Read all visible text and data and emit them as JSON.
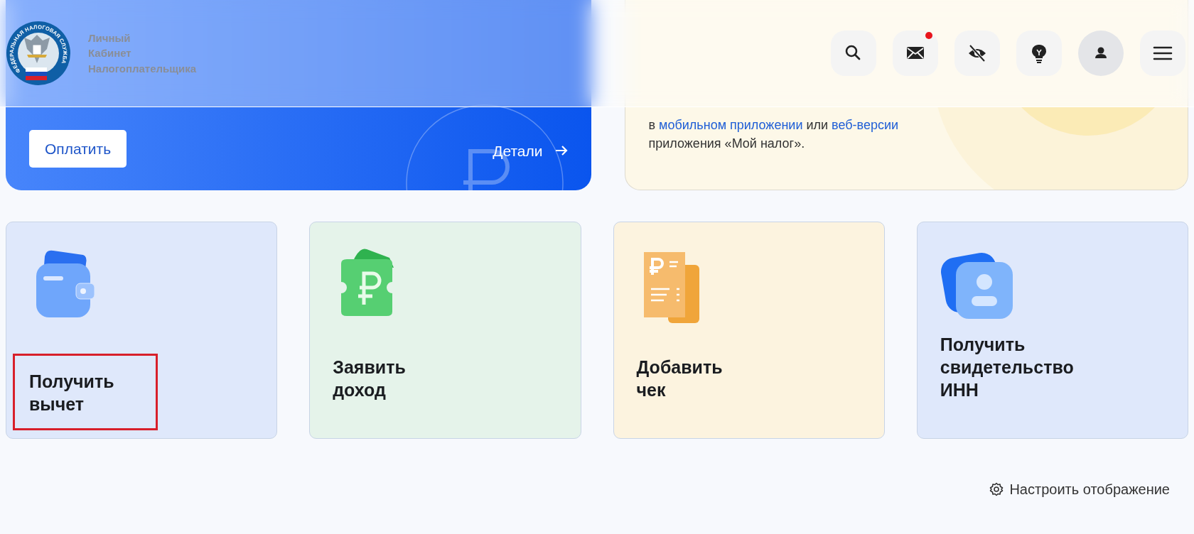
{
  "header": {
    "logo": {
      "ring_text": "ФЕДЕРАЛЬНАЯ НАЛОГОВАЯ СЛУЖБА"
    },
    "title_lines": [
      "Личный",
      "Кабинет",
      "Налогоплательщика"
    ],
    "actions": [
      {
        "kind": "search",
        "notification": false
      },
      {
        "kind": "mail",
        "notification": true
      },
      {
        "kind": "eye-off",
        "notification": false
      },
      {
        "kind": "bulb",
        "notification": false
      },
      {
        "kind": "user",
        "notification": false
      },
      {
        "kind": "menu",
        "notification": false
      }
    ]
  },
  "pay_banner": {
    "button": "Оплатить",
    "details": "Детали"
  },
  "info_banner": {
    "text_before": "в ",
    "link_1": "мобильном приложении",
    "text_middle": " или ",
    "link_2": "веб-версии",
    "text_after": "приложения «Мой налог»."
  },
  "tiles": [
    {
      "kind": "wallet",
      "title": "Получить вычет",
      "color": "#dfe8fb",
      "highlighted": true
    },
    {
      "kind": "ruble",
      "title": "Заявить доход",
      "color": "#e5f3ea",
      "highlighted": false
    },
    {
      "kind": "receipt",
      "title": "Добавить чек",
      "color": "#fcf3df",
      "highlighted": false
    },
    {
      "kind": "person",
      "title": "Получить свидетельство ИНН",
      "color": "#dfe8fb",
      "highlighted": false
    }
  ],
  "settings_link": "Настроить отображение"
}
